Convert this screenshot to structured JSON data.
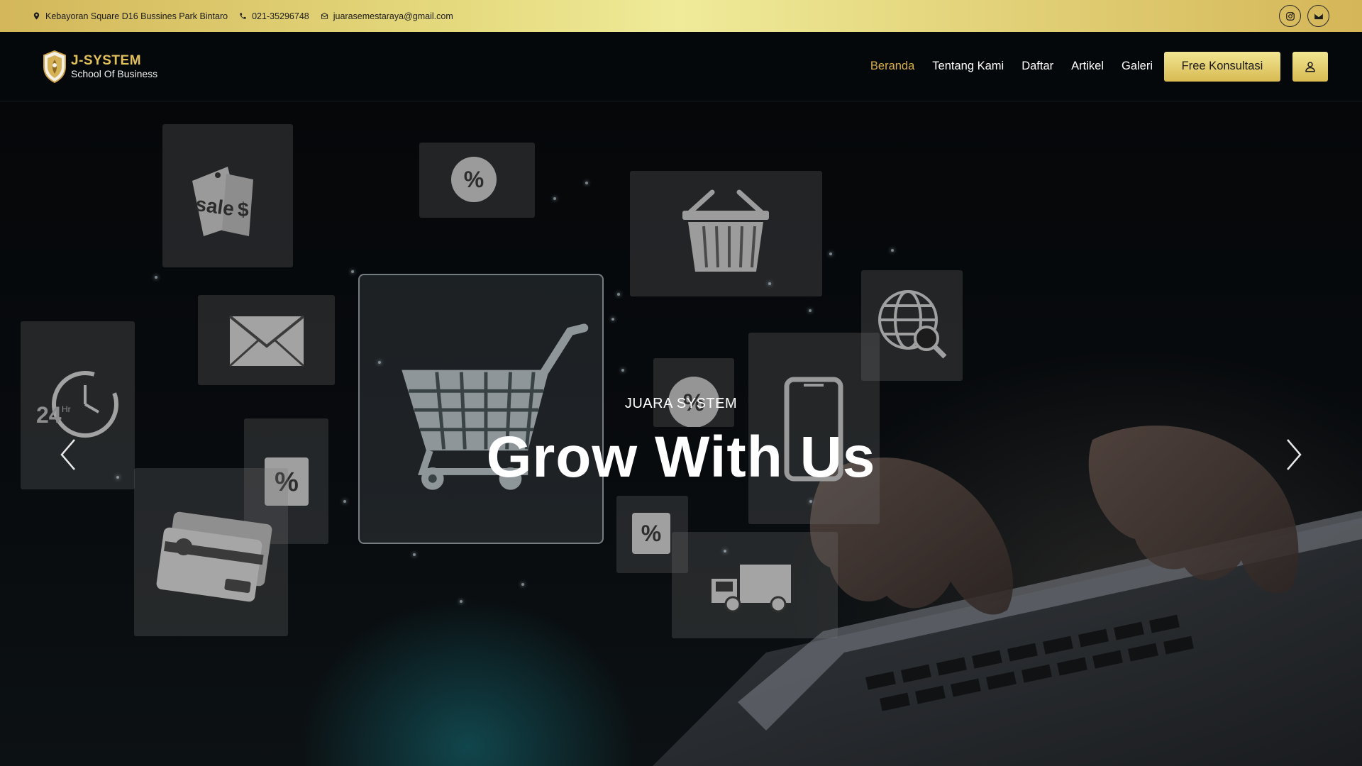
{
  "topbar": {
    "address": "Kebayoran Square D16 Bussines Park Bintaro",
    "phone": "021-35296748",
    "email": "juarasemestaraya@gmail.com",
    "social": [
      "instagram-icon",
      "envelope-icon"
    ]
  },
  "brand": {
    "title": "J-SYSTEM",
    "subtitle": "School Of Business",
    "accent": "#d8ae4e"
  },
  "nav": {
    "items": [
      {
        "label": "Beranda",
        "active": true
      },
      {
        "label": "Tentang Kami",
        "active": false
      },
      {
        "label": "Daftar",
        "active": false
      },
      {
        "label": "Artikel",
        "active": false
      },
      {
        "label": "Galeri",
        "active": false
      }
    ],
    "cta_label": "Free Konsultasi",
    "user_icon": "user-icon"
  },
  "hero": {
    "kicker": "JUARA SYSTEM",
    "title": "Grow With Us",
    "prev_icon": "chevron-left-icon",
    "next_icon": "chevron-right-icon",
    "tile_icons": [
      "sale-tags-icon",
      "percent-icon",
      "shopping-basket-icon",
      "globe-search-icon",
      "envelope-icon",
      "shopping-cart-icon",
      "clock-24hr-icon",
      "percent-icon",
      "smartphone-icon",
      "percent-icon",
      "percent-icon",
      "credit-card-icon",
      "delivery-truck-icon"
    ]
  }
}
